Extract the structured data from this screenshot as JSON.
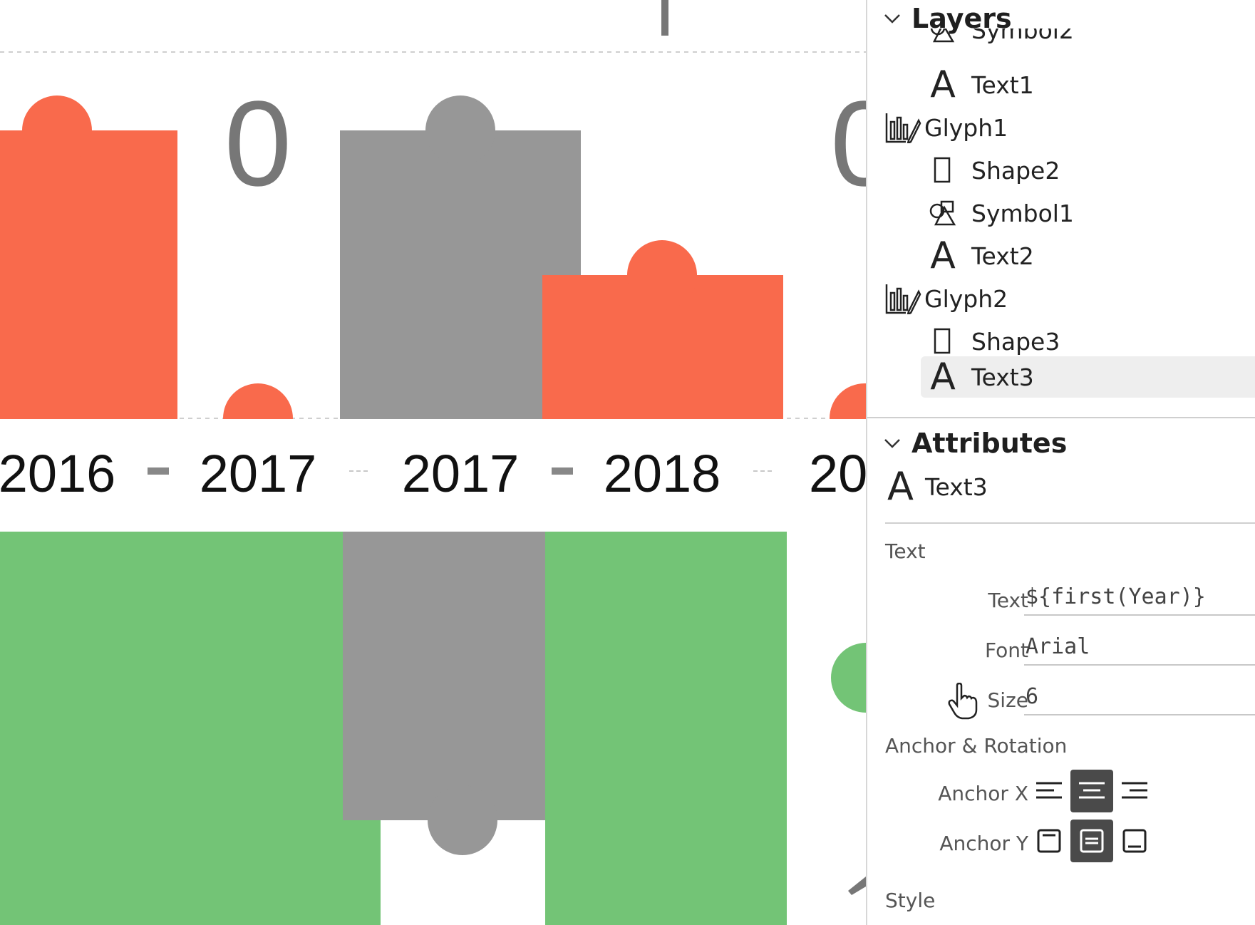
{
  "canvas": {
    "colors": {
      "red": "#F96A4C",
      "gray": "#979797",
      "green": "#73C476",
      "white": "#FFFFFF"
    },
    "value_labels": [
      "0",
      "0"
    ],
    "axis_labels": [
      "2016",
      "2017",
      "2017",
      "2018",
      "20"
    ]
  },
  "layers": {
    "title": "Layers",
    "items": [
      {
        "label": "Symbol2",
        "icon": "symbol-icon",
        "indent": 1,
        "selected": false
      },
      {
        "label": "Text1",
        "icon": "text-icon",
        "indent": 1,
        "selected": false
      },
      {
        "label": "Glyph1",
        "icon": "glyph-icon",
        "indent": 0,
        "selected": false
      },
      {
        "label": "Shape2",
        "icon": "shape-icon",
        "indent": 1,
        "selected": false
      },
      {
        "label": "Symbol1",
        "icon": "symbol-icon",
        "indent": 1,
        "selected": false
      },
      {
        "label": "Text2",
        "icon": "text-icon",
        "indent": 1,
        "selected": false
      },
      {
        "label": "Glyph2",
        "icon": "glyph-icon",
        "indent": 0,
        "selected": false
      },
      {
        "label": "Shape3",
        "icon": "shape-icon",
        "indent": 1,
        "selected": false
      },
      {
        "label": "Text3",
        "icon": "text-icon",
        "indent": 1,
        "selected": true
      }
    ]
  },
  "attributes": {
    "title": "Attributes",
    "object_name": "Text3",
    "groups": {
      "text": "Text",
      "anchor": "Anchor & Rotation",
      "style": "Style"
    },
    "fields": {
      "text_label": "Text",
      "text_value": "${first(Year)}",
      "font_label": "Font",
      "font_value": "Arial",
      "size_label": "Size",
      "size_value": "6"
    },
    "anchor_x_label": "Anchor X",
    "anchor_y_label": "Anchor Y",
    "anchor_x_selected": "middle",
    "anchor_y_selected": "middle"
  }
}
